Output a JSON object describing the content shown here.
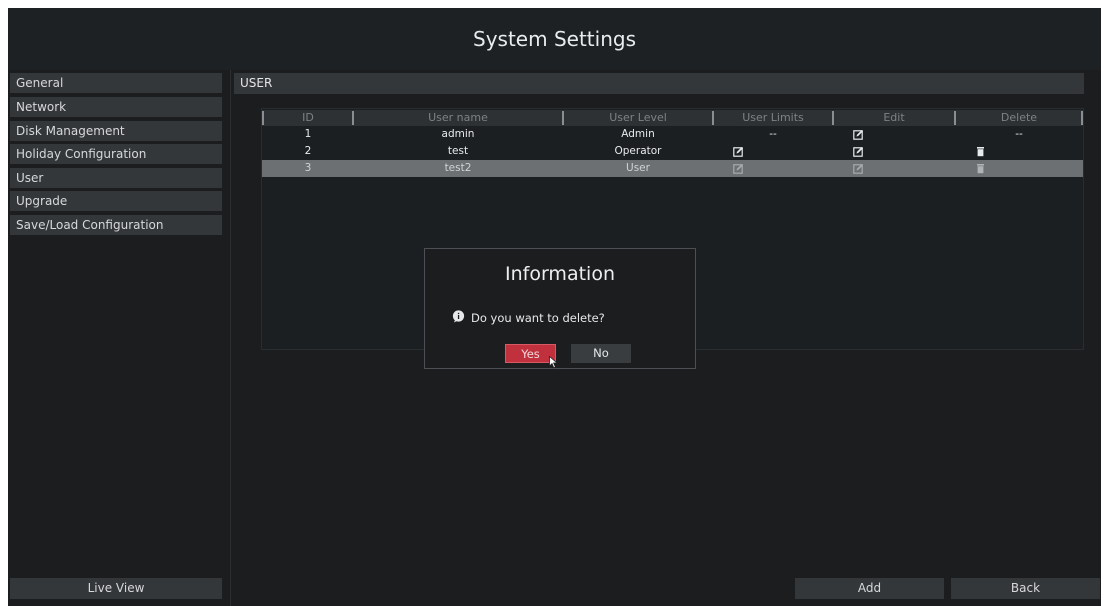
{
  "window": {
    "title": "System Settings"
  },
  "sidebar": {
    "items": [
      {
        "label": "General"
      },
      {
        "label": "Network"
      },
      {
        "label": "Disk Management"
      },
      {
        "label": "Holiday Configuration"
      },
      {
        "label": "User"
      },
      {
        "label": "Upgrade"
      },
      {
        "label": "Save/Load Configuration"
      }
    ],
    "live_view_label": "Live View"
  },
  "section": {
    "title": "USER"
  },
  "table": {
    "columns": [
      "ID",
      "User name",
      "User Level",
      "User Limits",
      "Edit",
      "Delete"
    ],
    "rows": [
      {
        "id": "1",
        "name": "admin",
        "level": "Admin",
        "limits": "--",
        "edit": "edit-icon",
        "delete": "--"
      },
      {
        "id": "2",
        "name": "test",
        "level": "Operator",
        "limits": "edit-icon",
        "edit": "edit-icon",
        "delete": "trash-icon"
      },
      {
        "id": "3",
        "name": "test2",
        "level": "User",
        "limits": "edit-icon",
        "edit": "edit-icon",
        "delete": "trash-icon",
        "selected": true
      }
    ]
  },
  "dialog": {
    "title": "Information",
    "message": "Do you want to delete?",
    "yes_label": "Yes",
    "no_label": "No",
    "icon": "info-bubble-icon"
  },
  "footer": {
    "add_label": "Add",
    "back_label": "Back"
  },
  "colors": {
    "background": "#1b1d1f",
    "accent": "#c1313d",
    "selected_row": "#6d7073"
  }
}
